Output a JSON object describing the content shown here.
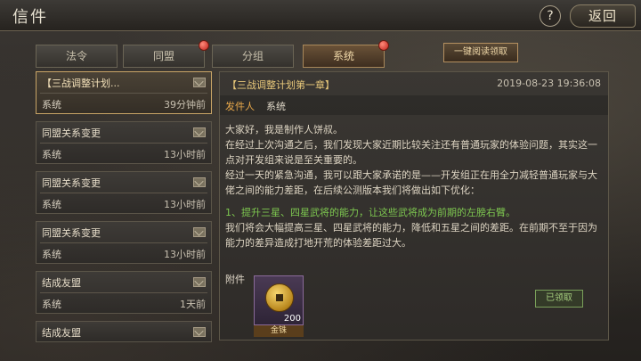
{
  "header": {
    "title": "信件",
    "help_label": "?",
    "back_label": "返回"
  },
  "tabs": [
    {
      "label": "法令",
      "active": false,
      "badge": false
    },
    {
      "label": "同盟",
      "active": false,
      "badge": true
    },
    {
      "label": "分组",
      "active": false,
      "badge": false
    },
    {
      "label": "系统",
      "active": true,
      "badge": true
    }
  ],
  "one_key_label": "一键阅读领取",
  "mails": [
    {
      "title": "【三战调整计划...",
      "sender": "系统",
      "time": "39分钟前",
      "selected": true
    },
    {
      "title": "同盟关系变更",
      "sender": "系统",
      "time": "13小时前",
      "selected": false
    },
    {
      "title": "同盟关系变更",
      "sender": "系统",
      "time": "13小时前",
      "selected": false
    },
    {
      "title": "同盟关系变更",
      "sender": "系统",
      "time": "13小时前",
      "selected": false
    },
    {
      "title": "结成友盟",
      "sender": "系统",
      "time": "1天前",
      "selected": false
    },
    {
      "title": "结成友盟",
      "sender": "",
      "time": "",
      "selected": false
    }
  ],
  "detail": {
    "heading": "【三战调整计划第一章】",
    "date": "2019-08-23 19:36:08",
    "sender_label": "发件人",
    "sender_value": "系统",
    "paragraphs": [
      "大家好，我是制作人饼叔。",
      "在经过上次沟通之后，我们发现大家近期比较关注还有普通玩家的体验问题，其实这一点对开发组来说是至关重要的。",
      "经过一天的紧急沟通，我可以跟大家承诺的是——开发组正在用全力减轻普通玩家与大佬之间的能力差距，在后续公测版本我们将做出如下优化："
    ],
    "highlight": "1、提升三星、四星武将的能力，让这些武将成为前期的左膀右臂。",
    "paragraph_after": "我们将会大幅提高三星、四星武将的能力，降低和五星之间的差距。在前期不至于因为能力的差异造成打地开荒的体验差距过大。",
    "attach_label": "附件",
    "attachment": {
      "name": "金铢",
      "qty": "200",
      "icon": "coin-icon"
    },
    "claimed_label": "已领取"
  },
  "colors": {
    "accent": "#e8c87a",
    "highlight": "#7ec850",
    "badge": "#c0201a"
  }
}
